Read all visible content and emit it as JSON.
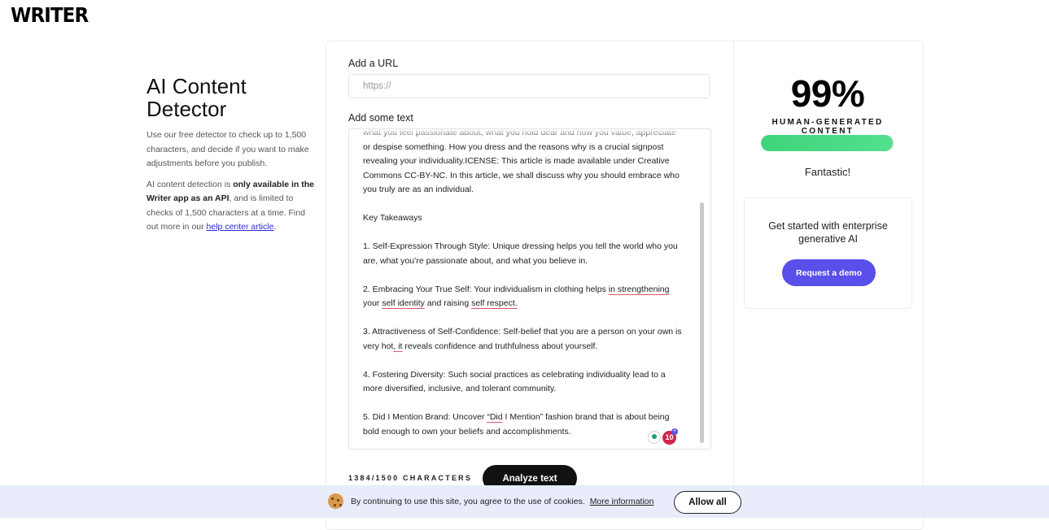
{
  "brand": {
    "logo": "WRITER"
  },
  "intro": {
    "title": "AI Content Detector",
    "p1": "Use our free detector to check up to 1,500 characters, and decide if you want to make adjustments before you publish.",
    "p2_prefix": "AI content detection is ",
    "p2_bold": "only available in the Writer app as an API",
    "p2_middle": ", and is limited to checks of 1,500 characters at a time. Find out more in our ",
    "p2_link": "help center article",
    "p2_suffix": "."
  },
  "form": {
    "url_label": "Add a URL",
    "url_placeholder": "https://",
    "text_label": "Add some text",
    "text_paragraphs": [
      [
        "what you feel passionate about, what you hold dear and how you value, appreciate or despise something. How you dress and the reasons why is a crucial signpost revealing your individuality.ICENSE: This article is made available under Creative Commons CC-BY-NC. In this article, we shall discuss why you should embrace who you truly are as an individual."
      ],
      [
        "Key Takeaways"
      ],
      [
        "1. Self-Expression Through Style: Unique dressing helps you tell the world who you are, what you’re passionate about, and what you believe in."
      ],
      [
        "2. Embracing Your True Self: Your individualism in clothing helps ",
        "in strengthening",
        " your ",
        "self identity",
        " and raising ",
        "self respect.",
        ""
      ],
      [
        "3. Attractiveness of Self-Confidence: Self-belief that you are a person on your own is very hot",
        ", it",
        " reveals confidence and truthfulness about yourself."
      ],
      [
        "4. Fostering Diversity: Such social practices as celebrating individuality lead to a more diversified, inclusive, and tolerant community."
      ],
      [
        "5. Did I Mention Brand: Uncover ",
        "“Did",
        " I Mention” fashion brand that is about being bold enough to own your beliefs and accomplishments."
      ]
    ],
    "badge_count": "10",
    "char_count": "1384/1500 CHARACTERS",
    "analyze_label": "Analyze text"
  },
  "result": {
    "percent": "99%",
    "percent_value": 99,
    "label": "HUMAN-GENERATED CONTENT",
    "verdict": "Fantastic!",
    "bar_color": "#3fd47a"
  },
  "promo": {
    "text": "Get started with enterprise generative AI",
    "button": "Request a demo",
    "accent": "#5a4fe8"
  },
  "cookies": {
    "text": "By continuing to use this site, you agree to the use of cookies.",
    "link": "More information",
    "button": "Allow all"
  }
}
